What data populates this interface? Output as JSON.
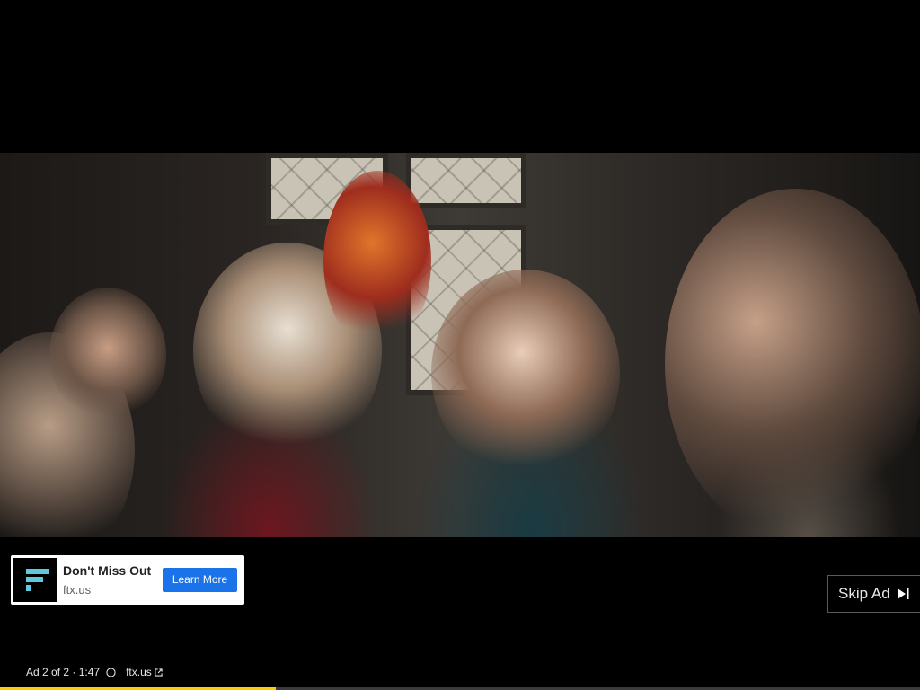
{
  "ad_card": {
    "title": "Don't Miss Out",
    "domain": "ftx.us",
    "cta_label": "Learn More",
    "logo_icon": "ftx-logo-icon",
    "cta_color": "#1a73e8"
  },
  "skip": {
    "label": "Skip Ad",
    "icon": "skip-next-icon"
  },
  "ad_info": {
    "counter": "Ad 2 of 2 · 1:47",
    "link_label": "ftx.us",
    "info_icon": "info-icon",
    "link_icon": "external-link-icon"
  },
  "progress": {
    "played_fraction": 0.3,
    "color": "#ffcc00"
  }
}
